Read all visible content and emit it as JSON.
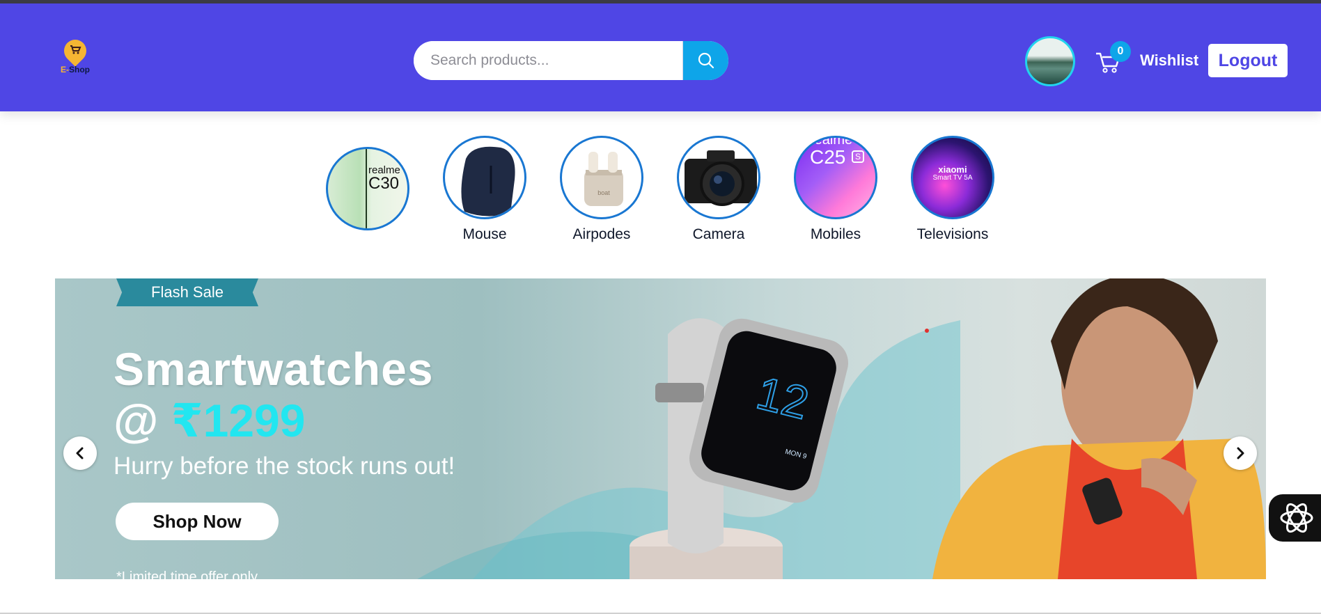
{
  "header": {
    "logo_text_prefix": "E-",
    "logo_text_suffix": "Shop",
    "search_placeholder": "Search products...",
    "cart_count": "0",
    "wishlist_label": "Wishlist",
    "logout_label": "Logout",
    "bg_color": "#4f46e5",
    "accent_color": "#0ea5e9"
  },
  "categories": [
    {
      "label": "",
      "icon": "realme-c30-phone"
    },
    {
      "label": "Mouse",
      "icon": "mouse"
    },
    {
      "label": "Airpodes",
      "icon": "earbuds"
    },
    {
      "label": "Camera",
      "icon": "camera"
    },
    {
      "label": "Mobiles",
      "icon": "realme-c25s-phone"
    },
    {
      "label": "Televisions",
      "icon": "xiaomi-tv"
    }
  ],
  "category_texts": {
    "realme": "realme",
    "c30": "C30",
    "c25": "C25",
    "s": "S",
    "xiaomi": "xiaomi",
    "smart_tv": "Smart TV 5A",
    "brand_boat": "boat"
  },
  "banner": {
    "tag": "Flash Sale",
    "title": "Smartwatches",
    "price_prefix": "@ ",
    "price": "₹1299",
    "subtitle": "Hurry before the stock runs out!",
    "cta": "Shop Now",
    "note": "*Limited time offer only",
    "watch_time": "12",
    "watch_date": "MON 9"
  }
}
